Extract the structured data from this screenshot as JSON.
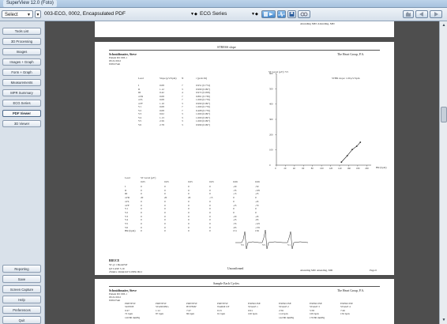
{
  "titlebar": {
    "title": "SuperView 12.0 (Foto)"
  },
  "toolbar": {
    "select_label": "Select",
    "document_title": "003-ECG, 0002, Encapsulated PDF",
    "series_label": "ECG Series"
  },
  "sidebar": {
    "items": [
      {
        "label": "Tools List"
      },
      {
        "label": "3D Processing"
      },
      {
        "label": "Images"
      },
      {
        "label": "Images + Graph"
      },
      {
        "label": "Form + Graph"
      },
      {
        "label": "Measurements"
      },
      {
        "label": "MPR Summary"
      },
      {
        "label": "ECG Series"
      },
      {
        "label": "PDF Viewer",
        "active": true
      },
      {
        "label": "3D Viewer"
      }
    ],
    "bottom_items": [
      {
        "label": "Reporting"
      },
      {
        "label": "Save"
      },
      {
        "label": "Screen Capture"
      },
      {
        "label": "Help"
      },
      {
        "label": "Preferences"
      },
      {
        "label": "Quit"
      }
    ]
  },
  "page1": {
    "top_right_text": "Attending MD: Attending, MD",
    "section_title": "STRESS slope",
    "patient_name": "Schmidtmaier, Steve",
    "patient_id": "Patient ID: 003-1",
    "date": "03/21/2012",
    "time": "9:09:27am",
    "company": "The Heart Group, P.A.",
    "table_headers": [
      "Lead",
      "Slope (μV/bpm)",
      "N",
      "r (prob.M)"
    ],
    "table_rows": [
      [
        "I",
        "0.08",
        "7",
        "0.951 (0.774)"
      ],
      [
        "II",
        "1.12",
        "3",
        "0.990 (0.097)"
      ],
      [
        "III",
        "0.42",
        "4",
        "0.972 (0.058)"
      ],
      [
        "aVR",
        "0.08",
        "7",
        "0.861 (0.736)"
      ],
      [
        "aVL",
        "0.08",
        "7",
        "1.000 (0.776)"
      ],
      [
        "aVF",
        "1.10",
        "3",
        "0.990 (0.097)"
      ],
      [
        "V1",
        "0.08",
        "7",
        "1.000 (0.776)"
      ],
      [
        "V2",
        "0.08",
        "7",
        "0.408 (0.776)"
      ],
      [
        "V3",
        "0.02",
        "3",
        "1.000 (0.097)"
      ],
      [
        "V4",
        "1.13",
        "3",
        "1.000 (0.097)"
      ],
      [
        "V5",
        "2.56",
        "3",
        "1.000 (0.097)"
      ],
      [
        "V6",
        "2.78",
        "3",
        "0.999 (0.097)"
      ]
    ],
    "chart_ylabel": "ST Level (μV)/ V5",
    "chart_annotation": "STHR slope: 1.06 μV/bpm",
    "chart_xlabel": "HR (bpm)",
    "st_headers": [
      "Lead",
      "ST Level (μV)"
    ],
    "st_hr_row": [
      "",
      "0.05",
      "0.05",
      "0.05",
      "0.05",
      "0.06",
      "0.06"
    ],
    "st_rows": [
      [
        "I",
        "0",
        "0",
        "0",
        "0",
        "-20",
        "-50"
      ],
      [
        "II",
        "0",
        "0",
        "0",
        "0",
        "-35",
        "-105"
      ],
      [
        "III",
        "0",
        "0",
        "0",
        "0",
        "-15",
        "-25"
      ],
      [
        "aVR",
        "20",
        "20",
        "20",
        "-15",
        "0",
        "0"
      ],
      [
        "aVL",
        "0",
        "0",
        "0",
        "0",
        "0",
        "-45"
      ],
      [
        "aVF",
        "0",
        "0",
        "0",
        "0",
        "-25",
        "-70"
      ],
      [
        "V1",
        "0",
        "0",
        "0",
        "0",
        "0",
        "0"
      ],
      [
        "V2",
        "0",
        "0",
        "0",
        "0",
        "0",
        "0"
      ],
      [
        "V3",
        "0",
        "0",
        "0",
        "0",
        "-20",
        "-45"
      ],
      [
        "V4",
        "0",
        "0",
        "0",
        "0",
        "-25",
        "-95"
      ],
      [
        "V5",
        "0",
        "0",
        "0",
        "0",
        "-55",
        "-125"
      ],
      [
        "V6",
        "0",
        "0",
        "0",
        "0",
        "-65",
        "-135"
      ],
      [
        "HR (bpm)",
        "0",
        "0",
        "0",
        "0",
        "151",
        "156"
      ]
    ],
    "strip_labels": [
      "V5",
      "V5",
      "V1"
    ],
    "footer_line1": "BRUCE",
    "footer_line2": "ST @ 1 Model%P",
    "footer_line3": "QT CASE 5.10",
    "footer_line4": "25mm/s  10mm/mV  0.05Hz  IM  2",
    "footer_center": "Unconfirmed",
    "footer_right": "Attending MD: Attending, MD",
    "page_number": "Page 6"
  },
  "page2": {
    "section_title": "Sample Each Cycles",
    "patient_name": "Schmidtmaier, Steve",
    "patient_id": "Patient ID: 003-1",
    "date": "03/21/2012",
    "time": "9:09:27am",
    "company": "The Heart Group, P.A.",
    "stage_headers": [
      "PRETEST SUPINE",
      "PRETEST STANDING",
      "PRETEST HYPERV",
      "PRETEST WARM UP",
      "EXERCISE STAGE 1",
      "EXERCISE STAGE 2",
      "EXERCISE STAGE 3",
      "EXERCISE STAGE 4"
    ],
    "stage_row1": [
      "0:47",
      "1:12",
      "7:47",
      "9:15",
      "0:01",
      "2:56",
      "5:58",
      "7:46"
    ],
    "stage_row2": [
      "72 bpm",
      "87 bpm",
      "86 bpm",
      "91 bpm",
      "100 bpm",
      "114 bpm",
      "109 bpm",
      "156 bpm"
    ],
    "stage_row3": [
      "120/80 mmHg",
      "",
      "",
      "",
      "",
      "142/80 mmHg",
      "170/80 mmHg",
      ""
    ]
  },
  "chart_data": {
    "type": "line",
    "x": [
      144,
      157,
      168,
      178,
      186
    ],
    "y": [
      20,
      62,
      102,
      124,
      150
    ],
    "xlabel": "HR (bpm)",
    "ylabel": "ST Level (μV)/ V5",
    "xlim": [
      0,
      210
    ],
    "ylim": [
      0,
      600
    ],
    "xticks": [
      0,
      20,
      40,
      60,
      80,
      100,
      120,
      140,
      160,
      180,
      200
    ],
    "yticks": [
      0,
      100,
      200,
      300,
      400,
      500,
      600
    ],
    "annotation": "STHR slope: 1.06 μV/bpm",
    "grid": false
  }
}
